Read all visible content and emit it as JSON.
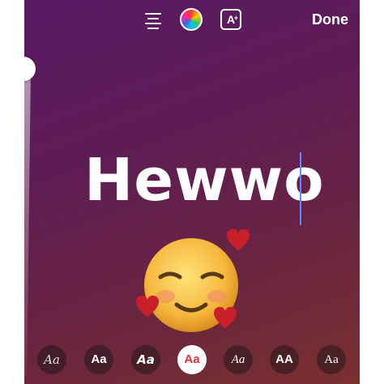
{
  "toolbar": {
    "align_icon": "align-center-icon",
    "color_icon": "color-wheel-icon",
    "effect_label": "A",
    "effect_badge": "+",
    "done_label": "Done"
  },
  "canvas": {
    "text": "Hewwo",
    "emoji": "smiling-face-with-hearts"
  },
  "fonts": [
    {
      "label": "Aa",
      "style": "script"
    },
    {
      "label": "Aa",
      "style": "classic"
    },
    {
      "label": "Aa",
      "style": "strong"
    },
    {
      "label": "Aa",
      "style": "rounded",
      "selected": true
    },
    {
      "label": "Aa",
      "style": "italic"
    },
    {
      "label": "AA",
      "style": "caps"
    },
    {
      "label": "Aa",
      "style": "serif"
    }
  ],
  "colors": {
    "accent": "#e23047",
    "caret": "#5b8cff"
  }
}
